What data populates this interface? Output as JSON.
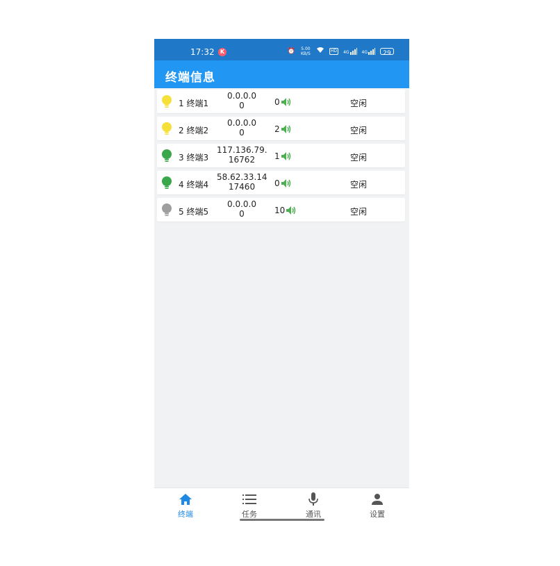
{
  "status_bar": {
    "time": "17:32",
    "badge": "K",
    "net_speed": "5.00 KB/S",
    "hd_label": "HD",
    "signal1": "4G",
    "signal2": "4G",
    "battery": "29"
  },
  "app_bar": {
    "title": "终端信息"
  },
  "terminals": [
    {
      "index": "1",
      "name": "终端1",
      "ip_line1": "0.0.0.0",
      "ip_line2": "0",
      "volume": "0",
      "status": "空闲",
      "bulb_color": "#f5e03a"
    },
    {
      "index": "2",
      "name": "终端2",
      "ip_line1": "0.0.0.0",
      "ip_line2": "0",
      "volume": "2",
      "status": "空闲",
      "bulb_color": "#f5e03a"
    },
    {
      "index": "3",
      "name": "终端3",
      "ip_line1": "117.136.79.",
      "ip_line2": "16762",
      "volume": "1",
      "status": "空闲",
      "bulb_color": "#3aa84a"
    },
    {
      "index": "4",
      "name": "终端4",
      "ip_line1": "58.62.33.14",
      "ip_line2": "17460",
      "volume": "0",
      "status": "空闲",
      "bulb_color": "#3aa84a"
    },
    {
      "index": "5",
      "name": "终端5",
      "ip_line1": "0.0.0.0",
      "ip_line2": "0",
      "volume": "10",
      "status": "空闲",
      "bulb_color": "#9e9e9e"
    }
  ],
  "bottom_nav": [
    {
      "label": "终端",
      "icon": "home-icon",
      "active": true
    },
    {
      "label": "任务",
      "icon": "list-icon",
      "active": false
    },
    {
      "label": "通讯",
      "icon": "microphone-icon",
      "active": false
    },
    {
      "label": "设置",
      "icon": "person-icon",
      "active": false
    }
  ],
  "colors": {
    "status_bar": "#1f79c8",
    "app_bar": "#2196f3",
    "accent": "#1e88e5",
    "volume_icon": "#4caf50",
    "background": "#f1f2f4"
  }
}
